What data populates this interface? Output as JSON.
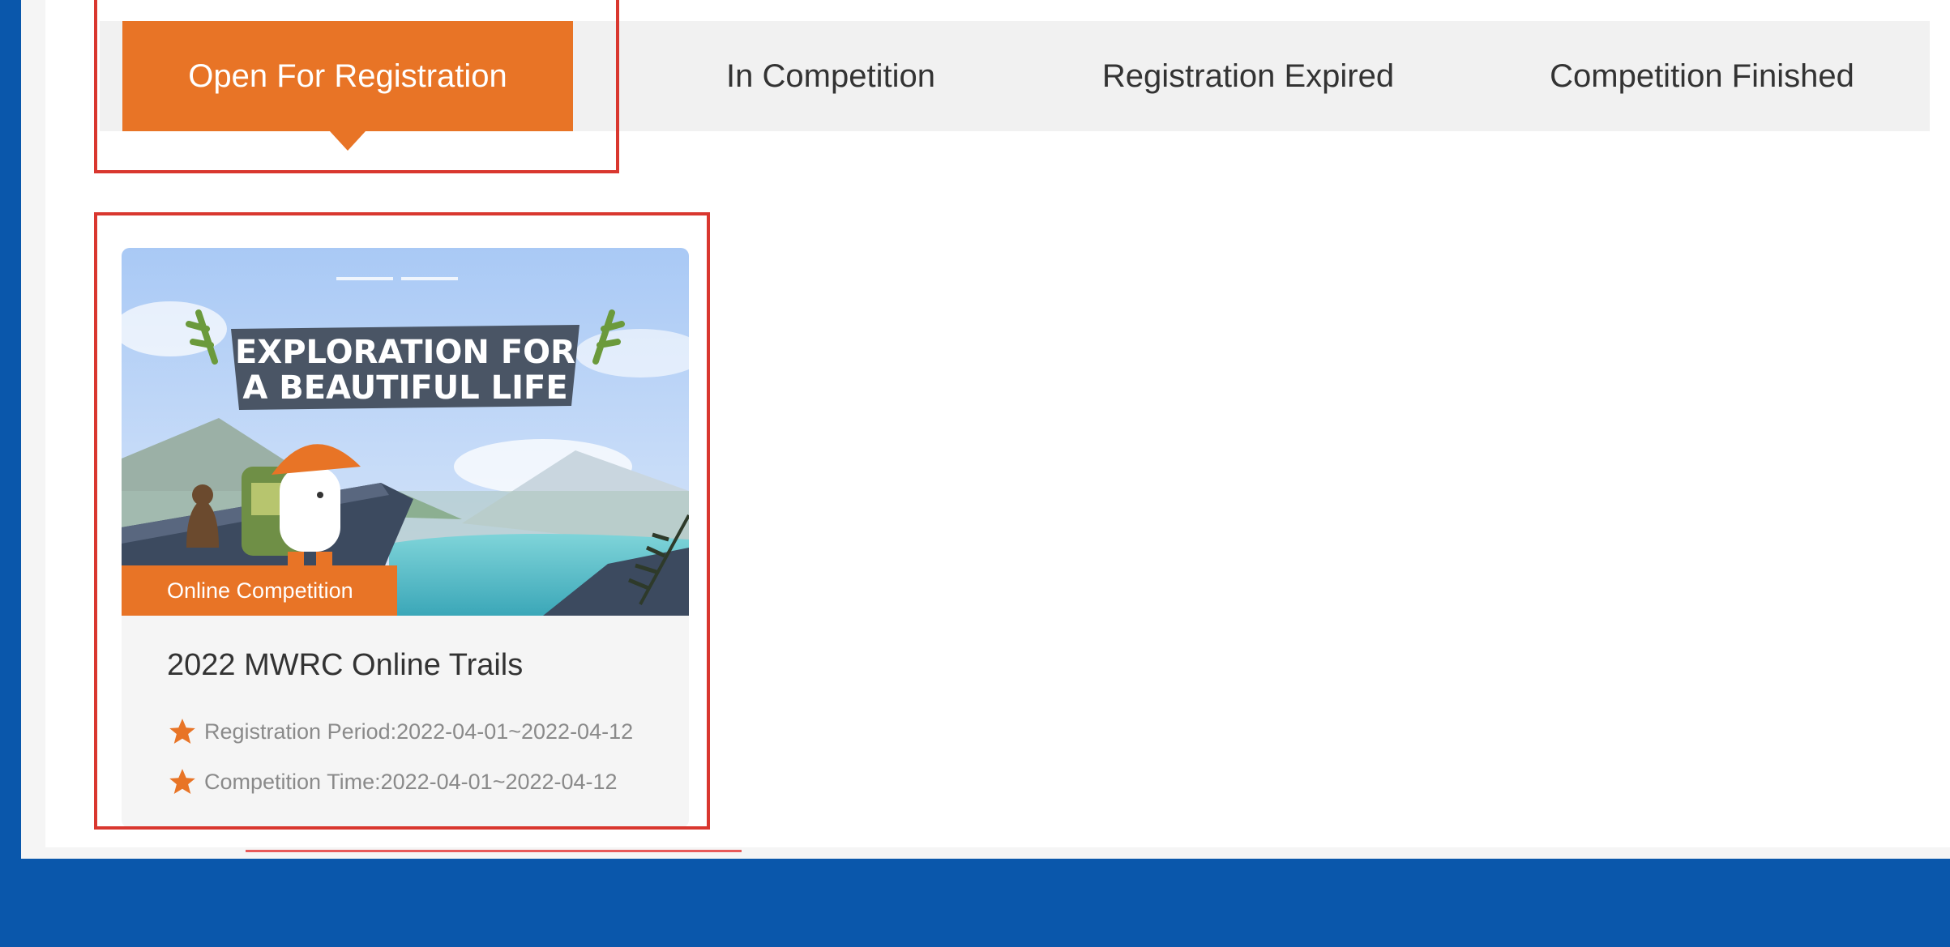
{
  "tabs": [
    {
      "label": "Open For Registration",
      "active": true
    },
    {
      "label": "In Competition",
      "active": false
    },
    {
      "label": "Registration Expired",
      "active": false
    },
    {
      "label": "Competition Finished",
      "active": false
    }
  ],
  "card": {
    "banner_line1": "EXPLORATION FOR",
    "banner_line2": "A BEAUTIFUL LIFE",
    "badge": "Online Competition",
    "title": "2022 MWRC Online Trails",
    "registration": "Registration Period:2022-04-01~2022-04-12",
    "competition": "Competition Time:2022-04-01~2022-04-12"
  },
  "colors": {
    "accent": "#e87426",
    "highlight": "#d9372f",
    "frame": "#0a57ab"
  },
  "icons": {
    "meta": "star-icon"
  }
}
